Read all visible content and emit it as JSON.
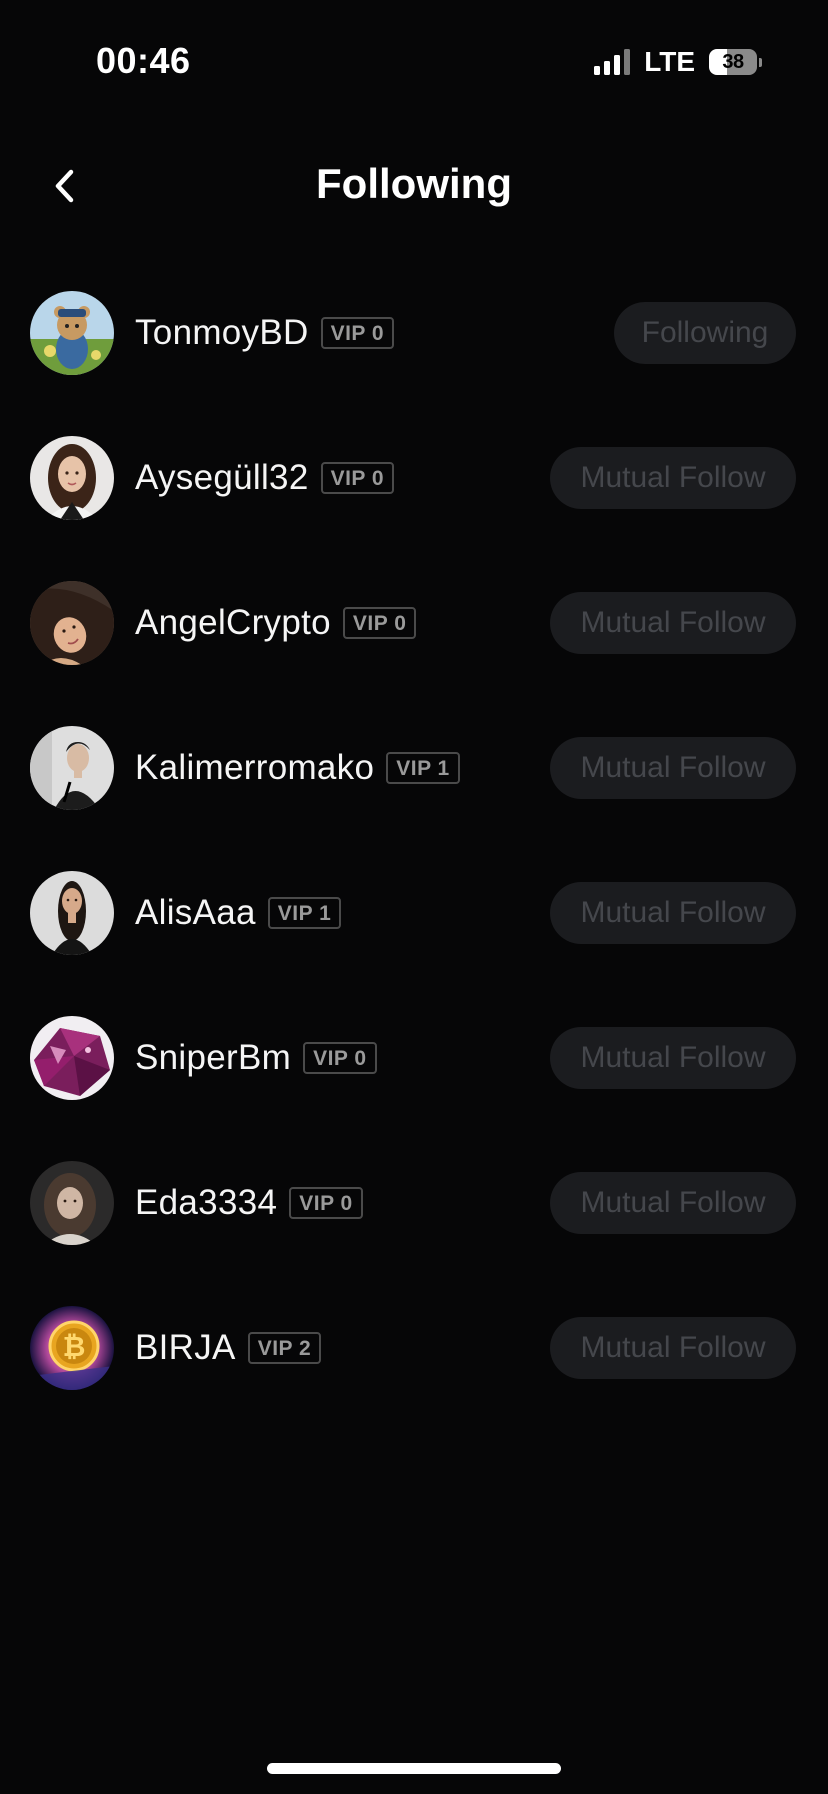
{
  "status_bar": {
    "time": "00:46",
    "network": "LTE",
    "battery": "38"
  },
  "header": {
    "title": "Following"
  },
  "users": [
    {
      "name": "TonmoyBD",
      "vip": "VIP 0",
      "button": "Following"
    },
    {
      "name": "Aysegüll32",
      "vip": "VIP 0",
      "button": "Mutual Follow"
    },
    {
      "name": "AngelCrypto",
      "vip": "VIP 0",
      "button": "Mutual Follow"
    },
    {
      "name": "Kalimerromako",
      "vip": "VIP 1",
      "button": "Mutual Follow"
    },
    {
      "name": "AlisAaa",
      "vip": "VIP 1",
      "button": "Mutual Follow"
    },
    {
      "name": "SniperBm",
      "vip": "VIP 0",
      "button": "Mutual Follow"
    },
    {
      "name": "Eda3334",
      "vip": "VIP 0",
      "button": "Mutual Follow"
    },
    {
      "name": "BIRJA",
      "vip": "VIP 2",
      "button": "Mutual Follow"
    }
  ],
  "colors": {
    "background": "#060607",
    "button_bg": "#1b1c1f",
    "button_text": "#45474c",
    "vip_border": "#4a4a4a"
  }
}
